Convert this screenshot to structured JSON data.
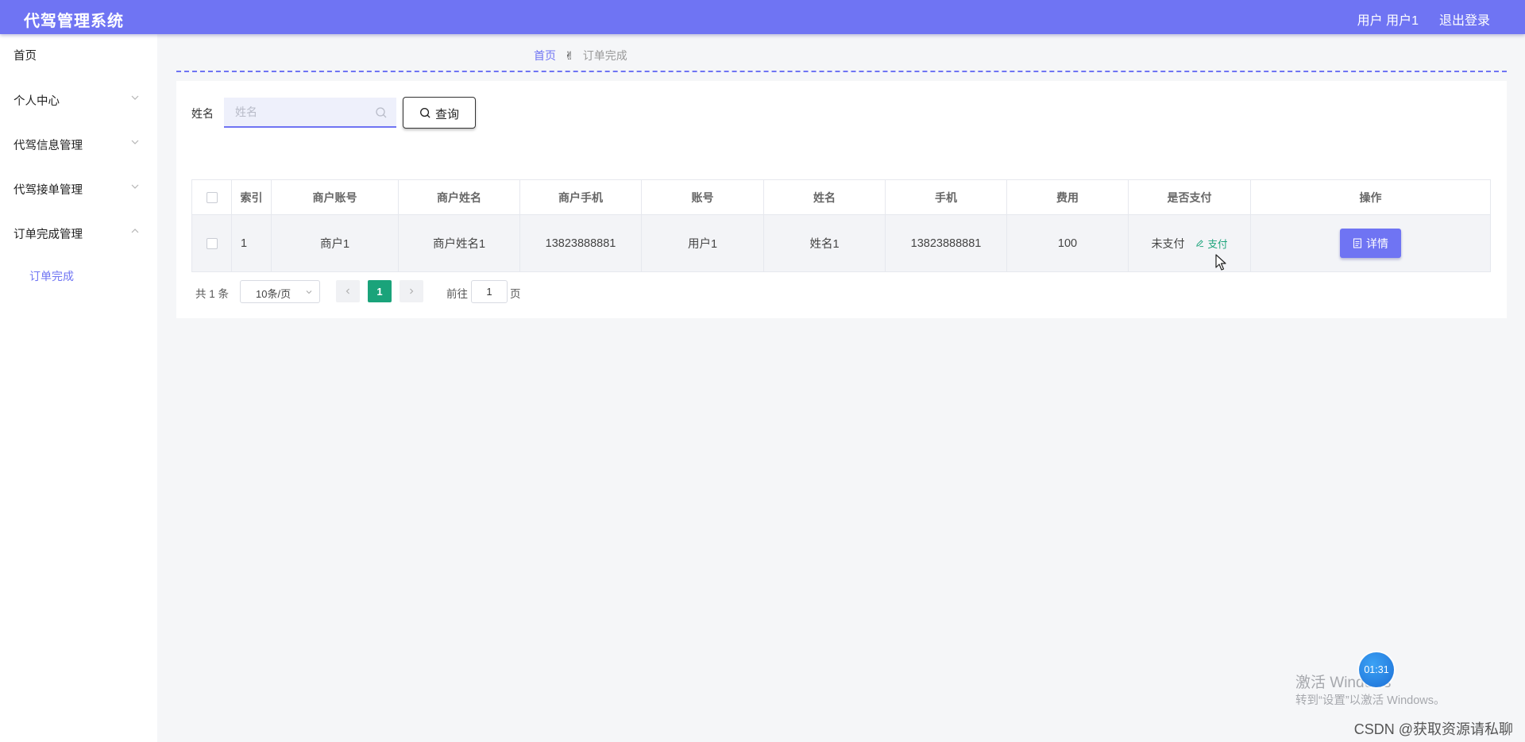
{
  "header": {
    "title": "代驾管理系统",
    "user_label": "用户 用户1",
    "logout_label": "退出登录"
  },
  "sidebar": {
    "items": [
      {
        "label": "首页"
      },
      {
        "label": "个人中心"
      },
      {
        "label": "代驾信息管理"
      },
      {
        "label": "代驾接单管理"
      },
      {
        "label": "订单完成管理"
      }
    ],
    "submenu": [
      {
        "label": "订单完成"
      }
    ]
  },
  "breadcrumb": {
    "home": "首页",
    "separator": "✌",
    "current": "订单完成"
  },
  "search": {
    "label": "姓名",
    "placeholder": "姓名",
    "value": "",
    "button_label": "查询"
  },
  "table": {
    "columns": [
      "索引",
      "商户账号",
      "商户姓名",
      "商户手机",
      "账号",
      "姓名",
      "手机",
      "费用",
      "是否支付",
      "操作"
    ],
    "rows": [
      {
        "index": "1",
        "merchant_account": "商户1",
        "merchant_name": "商户姓名1",
        "merchant_phone": "13823888881",
        "account": "用户1",
        "name": "姓名1",
        "phone": "13823888881",
        "fee": "100",
        "pay_status": "未支付",
        "pay_action": "支付",
        "detail_action": "详情"
      }
    ]
  },
  "pagination": {
    "total_text": "共 1 条",
    "page_size": "10条/页",
    "current_page": "1",
    "goto_prefix": "前往",
    "goto_value": "1",
    "goto_suffix": "页"
  },
  "overlay": {
    "watermark_title": "激活 Windows",
    "watermark_sub": "转到“设置”以激活 Windows。",
    "timer": "01:31",
    "credit": "CSDN @获取资源请私聊"
  },
  "colors": {
    "accent": "#6f74f3",
    "success": "#1aa37a",
    "page_bg": "#f5f6f8"
  }
}
